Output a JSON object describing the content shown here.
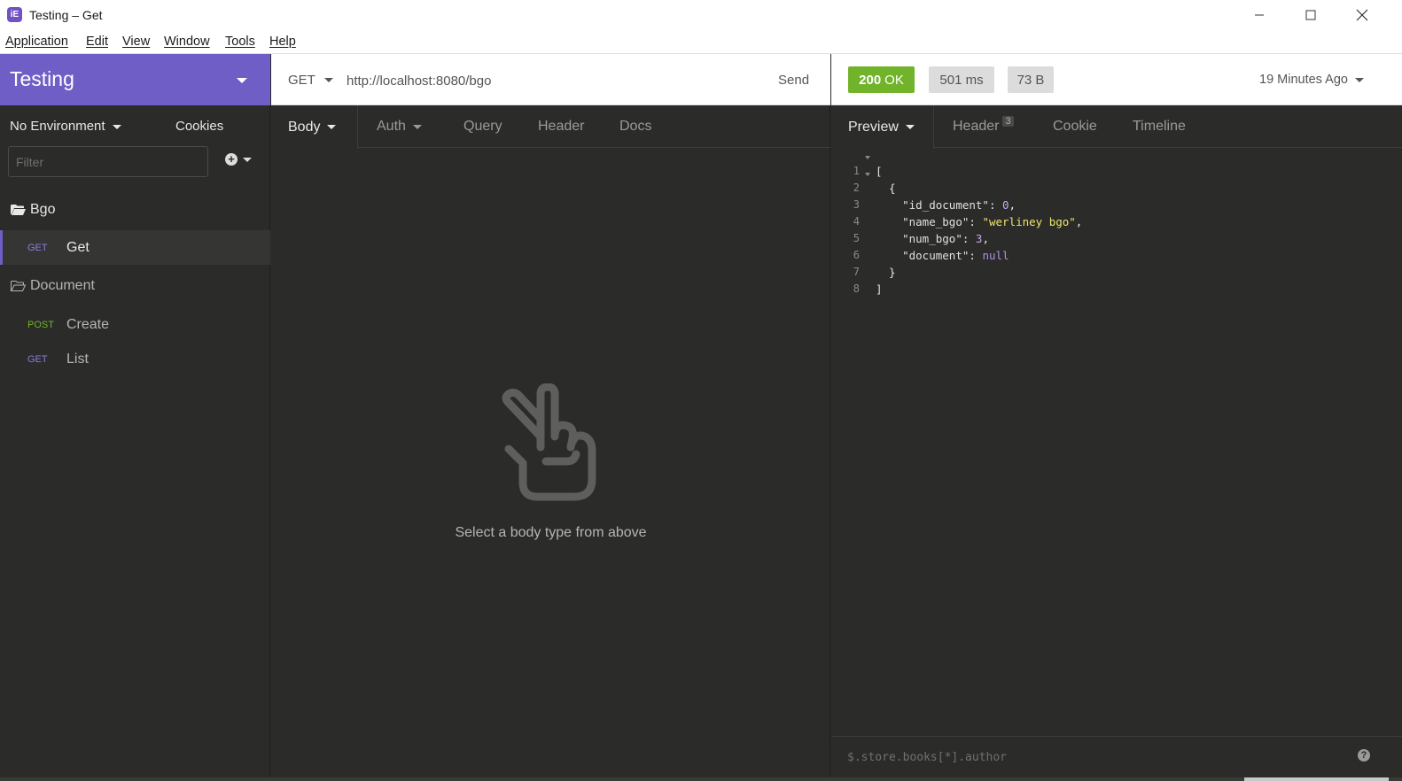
{
  "window": {
    "title": "Testing – Get",
    "app_icon": "insomnia-icon",
    "controls": [
      "minimize-icon",
      "maximize-icon",
      "close-icon"
    ]
  },
  "menu": {
    "items": [
      "Application",
      "Edit",
      "View",
      "Window",
      "Tools",
      "Help"
    ]
  },
  "sidebar": {
    "workspace": "Testing",
    "environment": "No Environment",
    "cookies": "Cookies",
    "filter_placeholder": "Filter",
    "folders": [
      {
        "name": "Bgo",
        "open": true,
        "requests": [
          {
            "method": "GET",
            "name": "Get",
            "active": true
          }
        ]
      },
      {
        "name": "Document",
        "open": true,
        "requests": [
          {
            "method": "POST",
            "name": "Create"
          },
          {
            "method": "GET",
            "name": "List"
          }
        ]
      }
    ]
  },
  "request": {
    "method": "GET",
    "url": "http://localhost:8080/bgo",
    "send_label": "Send",
    "tabs": [
      "Body",
      "Auth",
      "Query",
      "Header",
      "Docs"
    ],
    "empty_message": "Select a body type from above",
    "empty_icon": "peace-hand-icon"
  },
  "response": {
    "status": "200",
    "status_text": "OK",
    "time": "501 ms",
    "size": "73 B",
    "time_ago": "19 Minutes Ago",
    "tabs": [
      "Preview",
      "Header",
      "Cookie",
      "Timeline"
    ],
    "header_count": "3",
    "body_lines": [
      "[",
      "  {",
      "    \"id_document\": 0,",
      "    \"name_bgo\": \"werliney bgo\",",
      "    \"num_bgo\": 3,",
      "    \"document\": null",
      "  }",
      "]"
    ],
    "filter_placeholder": "$.store.books[*].author"
  },
  "colors": {
    "accent": "#6f5ec6",
    "get": "#8c7be0",
    "post": "#71b32a",
    "success": "#71b32a",
    "background": "#2b2b29"
  }
}
